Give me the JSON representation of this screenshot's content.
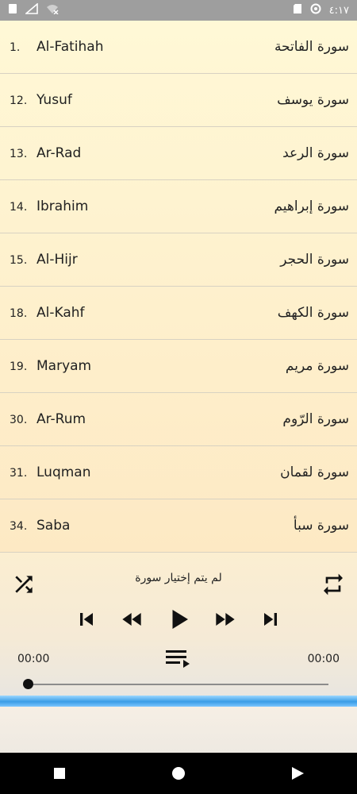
{
  "status_bar": {
    "time": "٤:١٧"
  },
  "surahs": [
    {
      "num": "1.",
      "name": "Al-Fatihah",
      "arabic": "سورة الفاتحة"
    },
    {
      "num": "12.",
      "name": "Yusuf",
      "arabic": "سورة يوسف"
    },
    {
      "num": "13.",
      "name": "Ar-Rad",
      "arabic": "سورة الرعد"
    },
    {
      "num": "14.",
      "name": "Ibrahim",
      "arabic": "سورة إبراهيم"
    },
    {
      "num": "15.",
      "name": "Al-Hijr",
      "arabic": "سورة الحجر"
    },
    {
      "num": "18.",
      "name": "Al-Kahf",
      "arabic": "سورة الكهف"
    },
    {
      "num": "19.",
      "name": "Maryam",
      "arabic": "سورة مريم"
    },
    {
      "num": "30.",
      "name": "Ar-Rum",
      "arabic": "سورة الرّوم"
    },
    {
      "num": "31.",
      "name": "Luqman",
      "arabic": "سورة لقمان"
    },
    {
      "num": "34.",
      "name": "Saba",
      "arabic": "سورة سبأ"
    }
  ],
  "player": {
    "now_playing": "لم يتم إختيار سورة",
    "elapsed": "00:00",
    "duration": "00:00",
    "progress": 0
  },
  "icons": {
    "shuffle": "shuffle-icon",
    "repeat": "repeat-icon",
    "prev": "skip-previous-icon",
    "rewind": "rewind-icon",
    "play": "play-icon",
    "forward": "fast-forward-icon",
    "next": "skip-next-icon",
    "queue": "queue-icon"
  },
  "colors": {
    "accent_band": "#3a9de6",
    "status_bar": "#9e9e9e",
    "list_bg": "#fff8d6"
  }
}
